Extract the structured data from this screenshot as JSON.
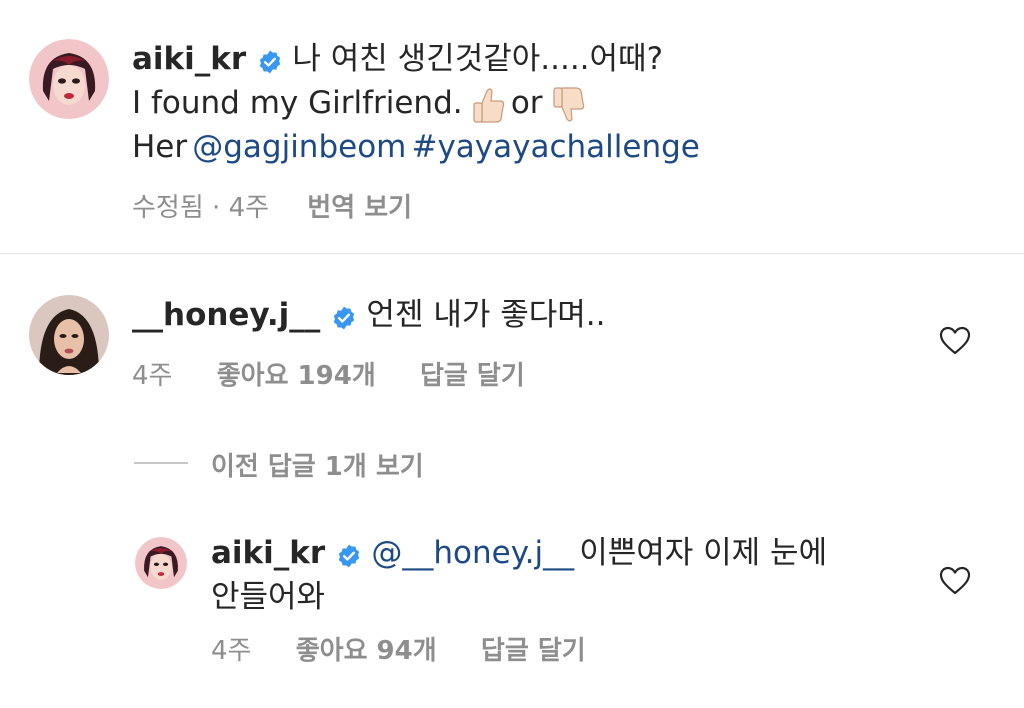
{
  "caption": {
    "username": "aiki_kr",
    "line1": "나 여친 생긴것같아.....어때?",
    "line2_text": "I found my Girlfriend.",
    "line2_or": "or",
    "line3_prefix": "Her",
    "mention": "@gagjinbeom",
    "hashtag": "#yayayachallenge",
    "edited": "수정됨",
    "dot": "·",
    "time": "4주",
    "translate": "번역 보기"
  },
  "comment1": {
    "username": "__honey.j__",
    "text": "언젠 내가 좋다며..",
    "time": "4주",
    "likes": "좋아요 194개",
    "reply": "답글 달기"
  },
  "view_replies": "이전 답글 1개 보기",
  "reply1": {
    "username": "aiki_kr",
    "mention": "@__honey.j__",
    "text_line1": "이쁜여자 이제 눈에",
    "text_line2": "안들어와",
    "time": "4주",
    "likes": "좋아요 94개",
    "reply": "답글 달기"
  },
  "colors": {
    "verified": "#3897f0",
    "link": "#1d4a85",
    "secondary": "#8e8e8e"
  },
  "icons": [
    "verified-badge-icon",
    "thumbs-up-emoji",
    "thumbs-down-emoji",
    "heart-icon"
  ]
}
